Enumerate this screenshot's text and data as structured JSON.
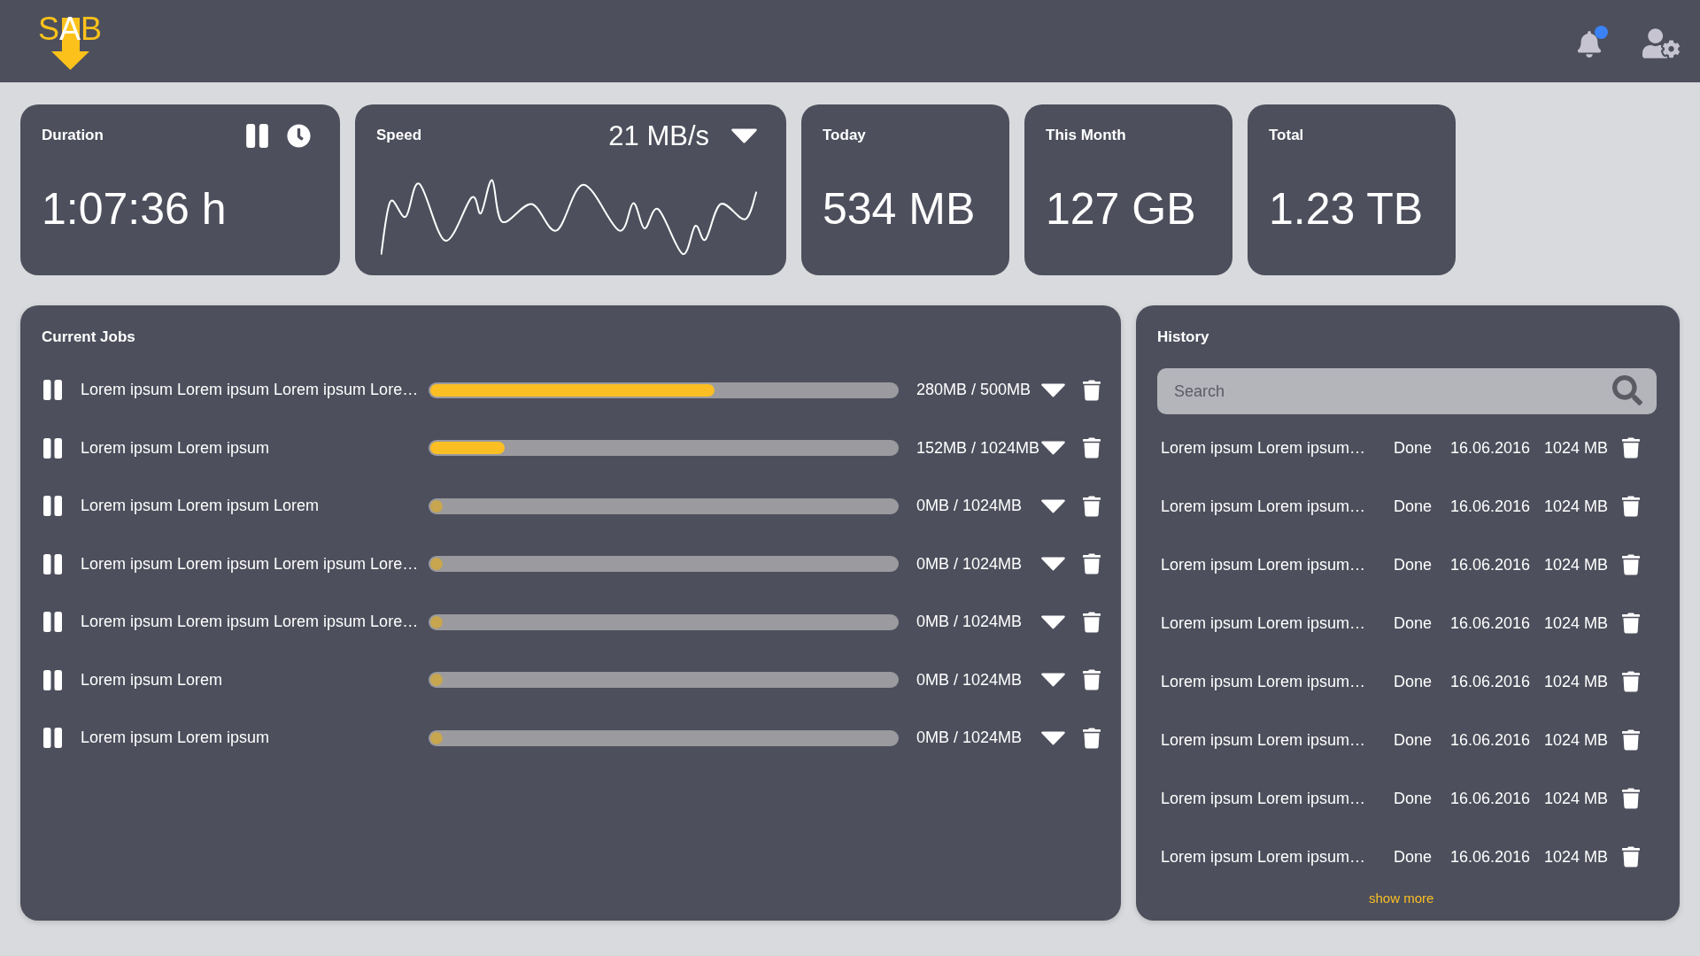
{
  "header": {
    "logo": {
      "letters": [
        {
          "char": "S",
          "highlighted": false
        },
        {
          "char": "A",
          "highlighted": true
        },
        {
          "char": "B",
          "highlighted": false
        }
      ]
    },
    "notifications": {
      "unread": true
    }
  },
  "stats": [
    {
      "kind": "duration",
      "label": "Duration",
      "value": "1:07:36 h"
    },
    {
      "kind": "speed",
      "label": "Speed",
      "value": "21 MB/s"
    },
    {
      "kind": "plain",
      "label": "Today",
      "value": "534 MB"
    },
    {
      "kind": "plain",
      "label": "This Month",
      "value": "127 GB"
    },
    {
      "kind": "plain",
      "label": "Total",
      "value": "1.23 TB"
    }
  ],
  "current_jobs": {
    "title": "Current Jobs",
    "jobs": [
      {
        "name": "Lorem ipsum Lorem ipsum Lorem ipsum Lore…",
        "level": 0.61,
        "size": "280MB / 500MB"
      },
      {
        "name": "Lorem ipsum Lorem ipsum",
        "level": 0.16,
        "size": "152MB / 1024MB"
      },
      {
        "name": "Lorem ipsum Lorem ipsum Lorem",
        "level": 0,
        "size": "0MB / 1024MB"
      },
      {
        "name": "Lorem ipsum Lorem ipsum Lorem ipsum Lore…",
        "level": 0,
        "size": "0MB / 1024MB"
      },
      {
        "name": "Lorem ipsum Lorem ipsum Lorem ipsum Lore…",
        "level": 0,
        "size": "0MB / 1024MB"
      },
      {
        "name": "Lorem ipsum Lorem",
        "level": 0,
        "size": "0MB / 1024MB"
      },
      {
        "name": "Lorem ipsum Lorem ipsum",
        "level": 0,
        "size": "0MB / 1024MB"
      }
    ]
  },
  "history": {
    "title": "History",
    "search": {
      "placeholder": "Search"
    },
    "rows": [
      {
        "name": "Lorem ipsum Lorem ipsum…",
        "status": "Done",
        "date": "16.06.2016",
        "size": "1024 MB"
      },
      {
        "name": "Lorem ipsum Lorem ipsum…",
        "status": "Done",
        "date": "16.06.2016",
        "size": "1024 MB"
      },
      {
        "name": "Lorem ipsum Lorem ipsum…",
        "status": "Done",
        "date": "16.06.2016",
        "size": "1024 MB"
      },
      {
        "name": "Lorem ipsum Lorem ipsum…",
        "status": "Done",
        "date": "16.06.2016",
        "size": "1024 MB"
      },
      {
        "name": "Lorem ipsum Lorem ipsum…",
        "status": "Done",
        "date": "16.06.2016",
        "size": "1024 MB"
      },
      {
        "name": "Lorem ipsum Lorem ipsum…",
        "status": "Done",
        "date": "16.06.2016",
        "size": "1024 MB"
      },
      {
        "name": "Lorem ipsum Lorem ipsum…",
        "status": "Done",
        "date": "16.06.2016",
        "size": "1024 MB"
      },
      {
        "name": "Lorem ipsum Lorem ipsum…",
        "status": "Done",
        "date": "16.06.2016",
        "size": "1024 MB"
      }
    ],
    "show_more": "show more"
  }
}
